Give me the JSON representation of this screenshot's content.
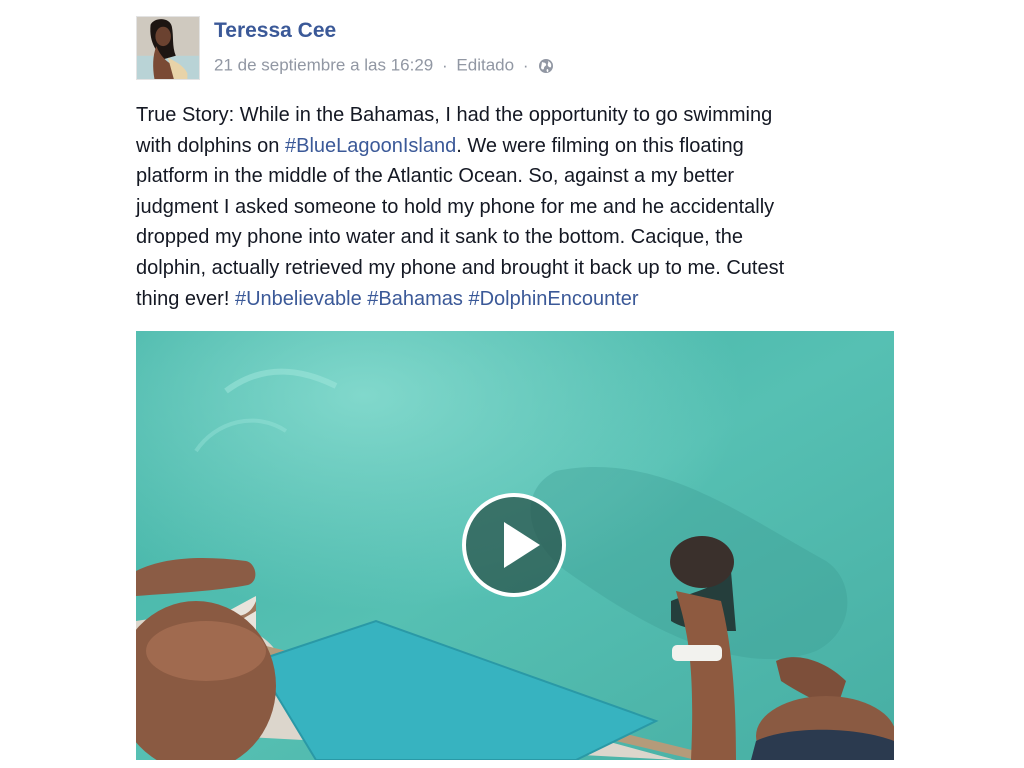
{
  "post": {
    "author": "Teressa Cee",
    "timestamp": "21 de septiembre a las 16:29",
    "edited_label": "Editado",
    "separator": "·",
    "privacy_icon": "globe-icon",
    "text_lines": [
      [
        {
          "t": "True Story: While in the Bahamas, I had the opportunity to go swimming"
        }
      ],
      [
        {
          "t": "with dolphins on "
        },
        {
          "t": "#BlueLagoonIsland",
          "tag": true
        },
        {
          "t": ". We were filming on this floating"
        }
      ],
      [
        {
          "t": "platform in the middle of the Atlantic Ocean. So, against a my better"
        }
      ],
      [
        {
          "t": "judgment I asked someone to hold my phone for me and he accidentally"
        }
      ],
      [
        {
          "t": "dropped my phone into water and it sank to the bottom. Cacique, the"
        }
      ],
      [
        {
          "t": "dolphin, actually retrieved my phone and brought it back up to me. Cutest"
        }
      ],
      [
        {
          "t": "thing ever! "
        },
        {
          "t": "#Unbelievable",
          "tag": true
        },
        {
          "t": " "
        },
        {
          "t": "#Bahamas",
          "tag": true
        },
        {
          "t": " "
        },
        {
          "t": "#DolphinEncounter",
          "tag": true
        }
      ]
    ],
    "video": {
      "play_icon": "play-icon"
    }
  },
  "colors": {
    "link": "#3b5998",
    "meta": "#9197a3",
    "text": "#141823",
    "water": "#4fb6a9"
  }
}
